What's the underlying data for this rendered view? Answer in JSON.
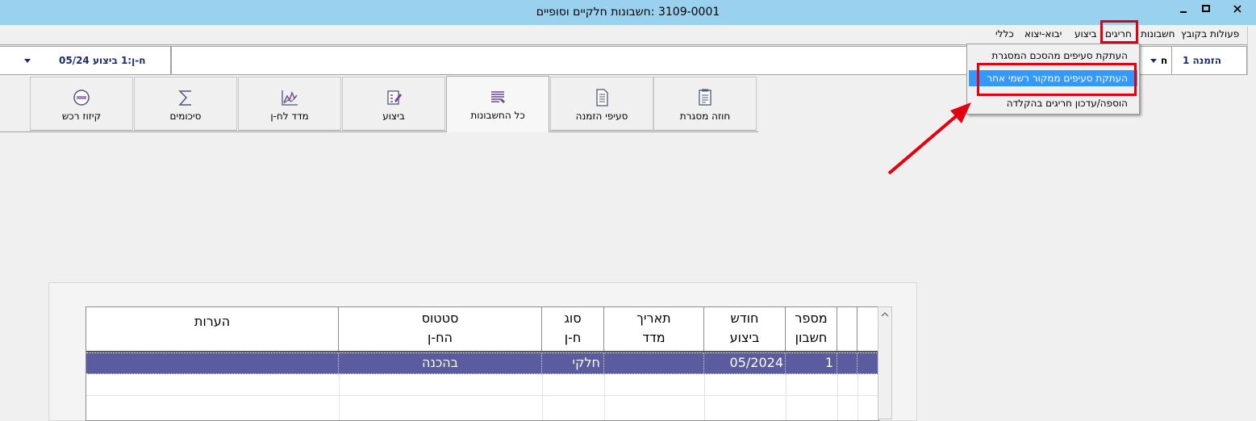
{
  "window": {
    "title": "3109-0001 :חשבונות חלקיים וסופיים",
    "controls": [
      "minimize",
      "maximize",
      "close"
    ]
  },
  "menubar": {
    "items": [
      "פעולות בקובץ",
      "חשבונות",
      "חריגים",
      "ביצוע",
      "יבוא-יצוא",
      "כללי"
    ]
  },
  "toolbar": {
    "order_label": "הזמנה 1",
    "execution_label": "ח-ן:1 ביצוע 05/24",
    "partial_letter": "ח"
  },
  "dropdown": {
    "items": [
      "העתקת סעיפים מהסכם המסגרת",
      "העתקת סעיפים ממקור רשמי אחר",
      "הוספה/עדכון חריגים בהקלדה"
    ],
    "highlighted_index": 1
  },
  "tabs": [
    {
      "label": "חוזה מסגרת",
      "icon": "contract-icon"
    },
    {
      "label": "סעיפי הזמנה",
      "icon": "order-items-icon"
    },
    {
      "label": "כל החשבונות",
      "icon": "all-accounts-icon",
      "active": true
    },
    {
      "label": "ביצוע",
      "icon": "execution-icon"
    },
    {
      "label": "מדד לח-ן",
      "icon": "index-chart-icon"
    },
    {
      "label": "סיכומים",
      "icon": "sigma-icon"
    },
    {
      "label": "קיזוז רכש",
      "icon": "offset-icon"
    }
  ],
  "grid": {
    "headers": [
      {
        "l1": "מספר",
        "l2": "חשבון"
      },
      {
        "l1": "חודש",
        "l2": "ביצוע"
      },
      {
        "l1": "תאריך",
        "l2": "מדד"
      },
      {
        "l1": "סוג",
        "l2": "ח-ן"
      },
      {
        "l1": "סטטוס",
        "l2": "הח-ן"
      },
      {
        "l1": "",
        "l2": "הערות"
      }
    ],
    "rows": [
      {
        "account": "1",
        "month": "05/2024",
        "index_date": "",
        "type": "חלקי",
        "status": "בהכנה",
        "notes": ""
      }
    ]
  },
  "colors": {
    "titlebar": "#99d1ef",
    "selected_row": "#5b5b9f",
    "menu_highlight": "#3399ff",
    "annotation": "#e3000f"
  }
}
